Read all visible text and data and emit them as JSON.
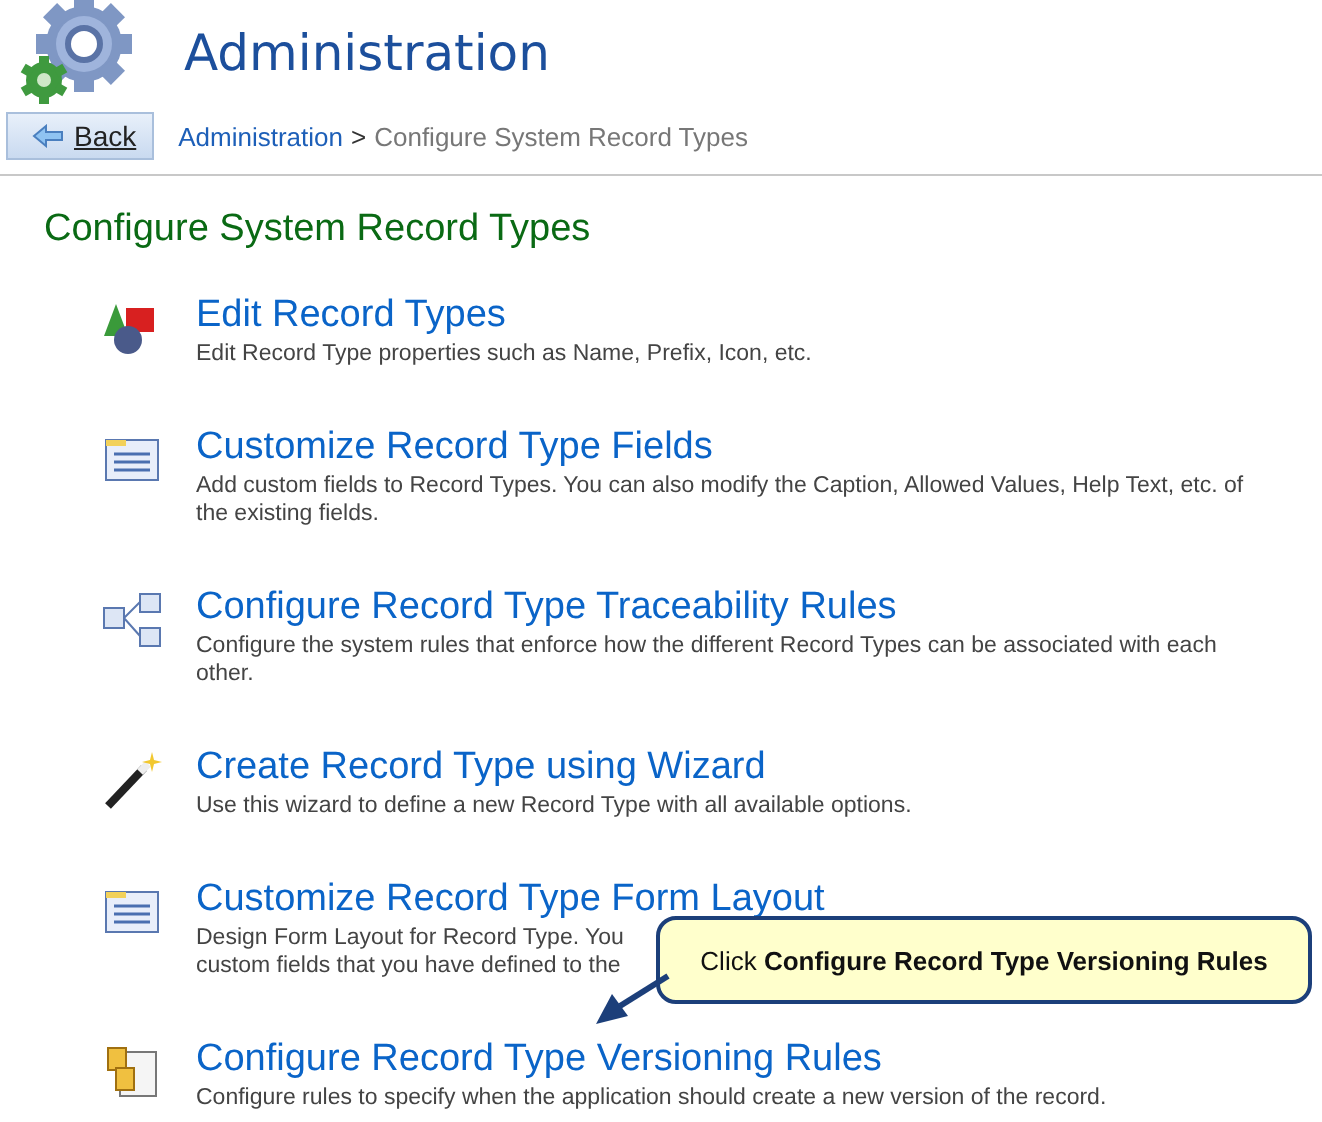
{
  "header": {
    "title": "Administration"
  },
  "back_button": {
    "label": "Back"
  },
  "breadcrumb": {
    "link": "Administration",
    "separator": ">",
    "current": "Configure System Record Types"
  },
  "section_title": "Configure System Record Types",
  "items": [
    {
      "kind": "shapes",
      "title": "Edit Record Types",
      "description_lines": [
        "Edit Record Type properties such as Name, Prefix, Icon, etc."
      ]
    },
    {
      "kind": "form",
      "title": "Customize Record Type Fields",
      "description_lines": [
        "Add custom fields to Record Types. You can also modify the Caption, Allowed Values, Help Text, etc. of",
        "the existing fields."
      ]
    },
    {
      "kind": "tree",
      "title": "Configure Record Type Traceability Rules",
      "description_lines": [
        "Configure the system rules that enforce how the different Record Types can be associated with each",
        "other."
      ]
    },
    {
      "kind": "wand",
      "title": "Create Record Type using Wizard",
      "description_lines": [
        "Use this wizard to define a new Record Type with all available options."
      ]
    },
    {
      "kind": "form",
      "title": "Customize Record Type Form Layout",
      "description_lines": [
        "Design Form Layout for Record Type. You",
        "custom fields that you have defined to the"
      ]
    },
    {
      "kind": "pages",
      "title": "Configure Record Type Versioning Rules",
      "description_lines": [
        "Configure rules to specify when the application should create a new version of the record."
      ]
    }
  ],
  "callout": {
    "text": "Click **Configure Record Type Versioning Rules**"
  }
}
